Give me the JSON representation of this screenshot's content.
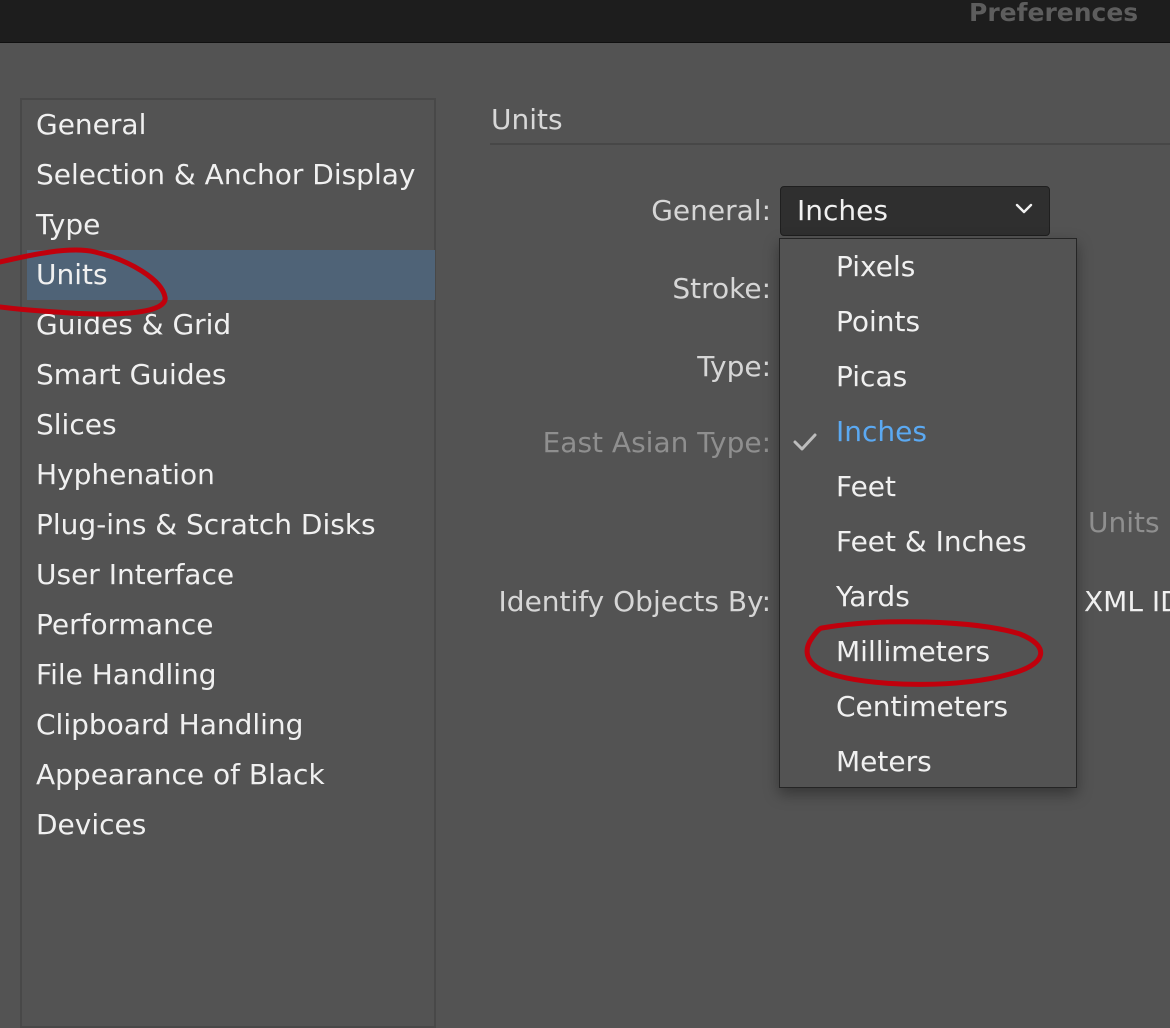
{
  "window": {
    "title": "Preferences"
  },
  "sidebar": {
    "items": [
      {
        "label": "General"
      },
      {
        "label": "Selection & Anchor Display"
      },
      {
        "label": "Type"
      },
      {
        "label": "Units",
        "selected": true
      },
      {
        "label": "Guides & Grid"
      },
      {
        "label": "Smart Guides"
      },
      {
        "label": "Slices"
      },
      {
        "label": "Hyphenation"
      },
      {
        "label": "Plug-ins & Scratch Disks"
      },
      {
        "label": "User Interface"
      },
      {
        "label": "Performance"
      },
      {
        "label": "File Handling"
      },
      {
        "label": "Clipboard Handling"
      },
      {
        "label": "Appearance of Black"
      },
      {
        "label": "Devices"
      }
    ]
  },
  "units_panel": {
    "title": "Units",
    "fields": {
      "general": "General:",
      "stroke": "Stroke:",
      "type": "Type:",
      "east_asian_type": "East Asian Type:",
      "identify_objects_by": "Identify Objects By:"
    },
    "general_select": {
      "value": "Inches"
    },
    "partially_hidden": {
      "units": "Units",
      "xml_id": "XML ID"
    }
  },
  "dropdown": {
    "options": [
      {
        "label": "Pixels"
      },
      {
        "label": "Points"
      },
      {
        "label": "Picas"
      },
      {
        "label": "Inches",
        "checked": true
      },
      {
        "label": "Feet"
      },
      {
        "label": "Feet & Inches"
      },
      {
        "label": "Yards"
      },
      {
        "label": "Millimeters"
      },
      {
        "label": "Centimeters"
      },
      {
        "label": "Meters"
      }
    ]
  },
  "colors": {
    "background": "#535353",
    "titlebar": "#1d1d1d",
    "selection": "#4f6377",
    "checked_option": "#5ba9f2",
    "annotation": "#c0000c"
  }
}
